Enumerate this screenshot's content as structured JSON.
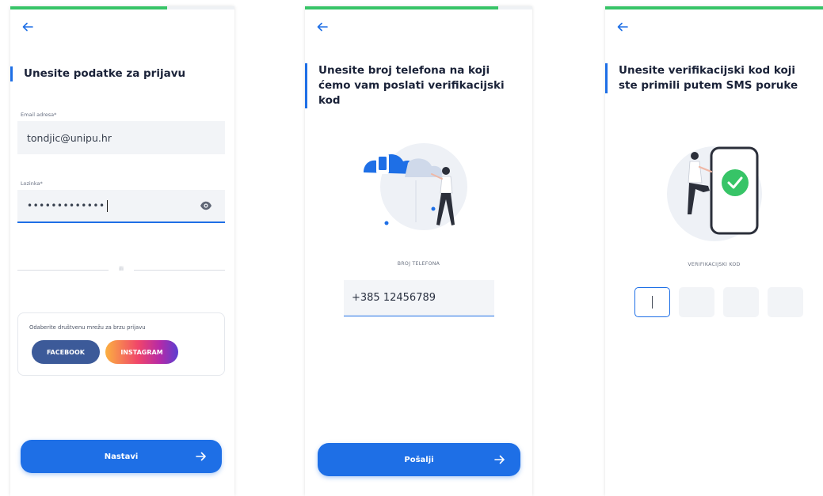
{
  "screen1": {
    "title": "Unesite podatke za prijavu",
    "email_label": "Email adresa*",
    "email_value": "tondjic@unipu.hr",
    "password_label": "Lozinka*",
    "password_mask": "•••••••••••••",
    "divider_text": "ili",
    "social_label": "Odaberite društvenu mrežu za brzu prijavu",
    "facebook_label": "FACEBOOK",
    "instagram_label": "INSTAGRAM",
    "continue_label": "Nastavi",
    "progress": 0.7
  },
  "screen2": {
    "title": "Unesite broj telefona na koji ćemo vam poslati verifikacijski kod",
    "phone_label": "BROJ TELEFONA",
    "phone_value": "+385 12456789",
    "send_label": "Pošalji",
    "progress": 0.85
  },
  "screen3": {
    "title": "Unesite verifikacijski kod koji ste primili putem SMS poruke",
    "code_label": "VERIFIKACIJSKI KOD",
    "code_boxes": 4,
    "progress": 1.0
  },
  "colors": {
    "accent": "#1e6fe6",
    "progress": "#37c467",
    "facebook": "#3c5a99",
    "field_bg": "#f2f4f7"
  },
  "icons": [
    "back-arrow-icon",
    "eye-icon",
    "right-arrow-icon",
    "phone-illustration",
    "verification-illustration"
  ]
}
